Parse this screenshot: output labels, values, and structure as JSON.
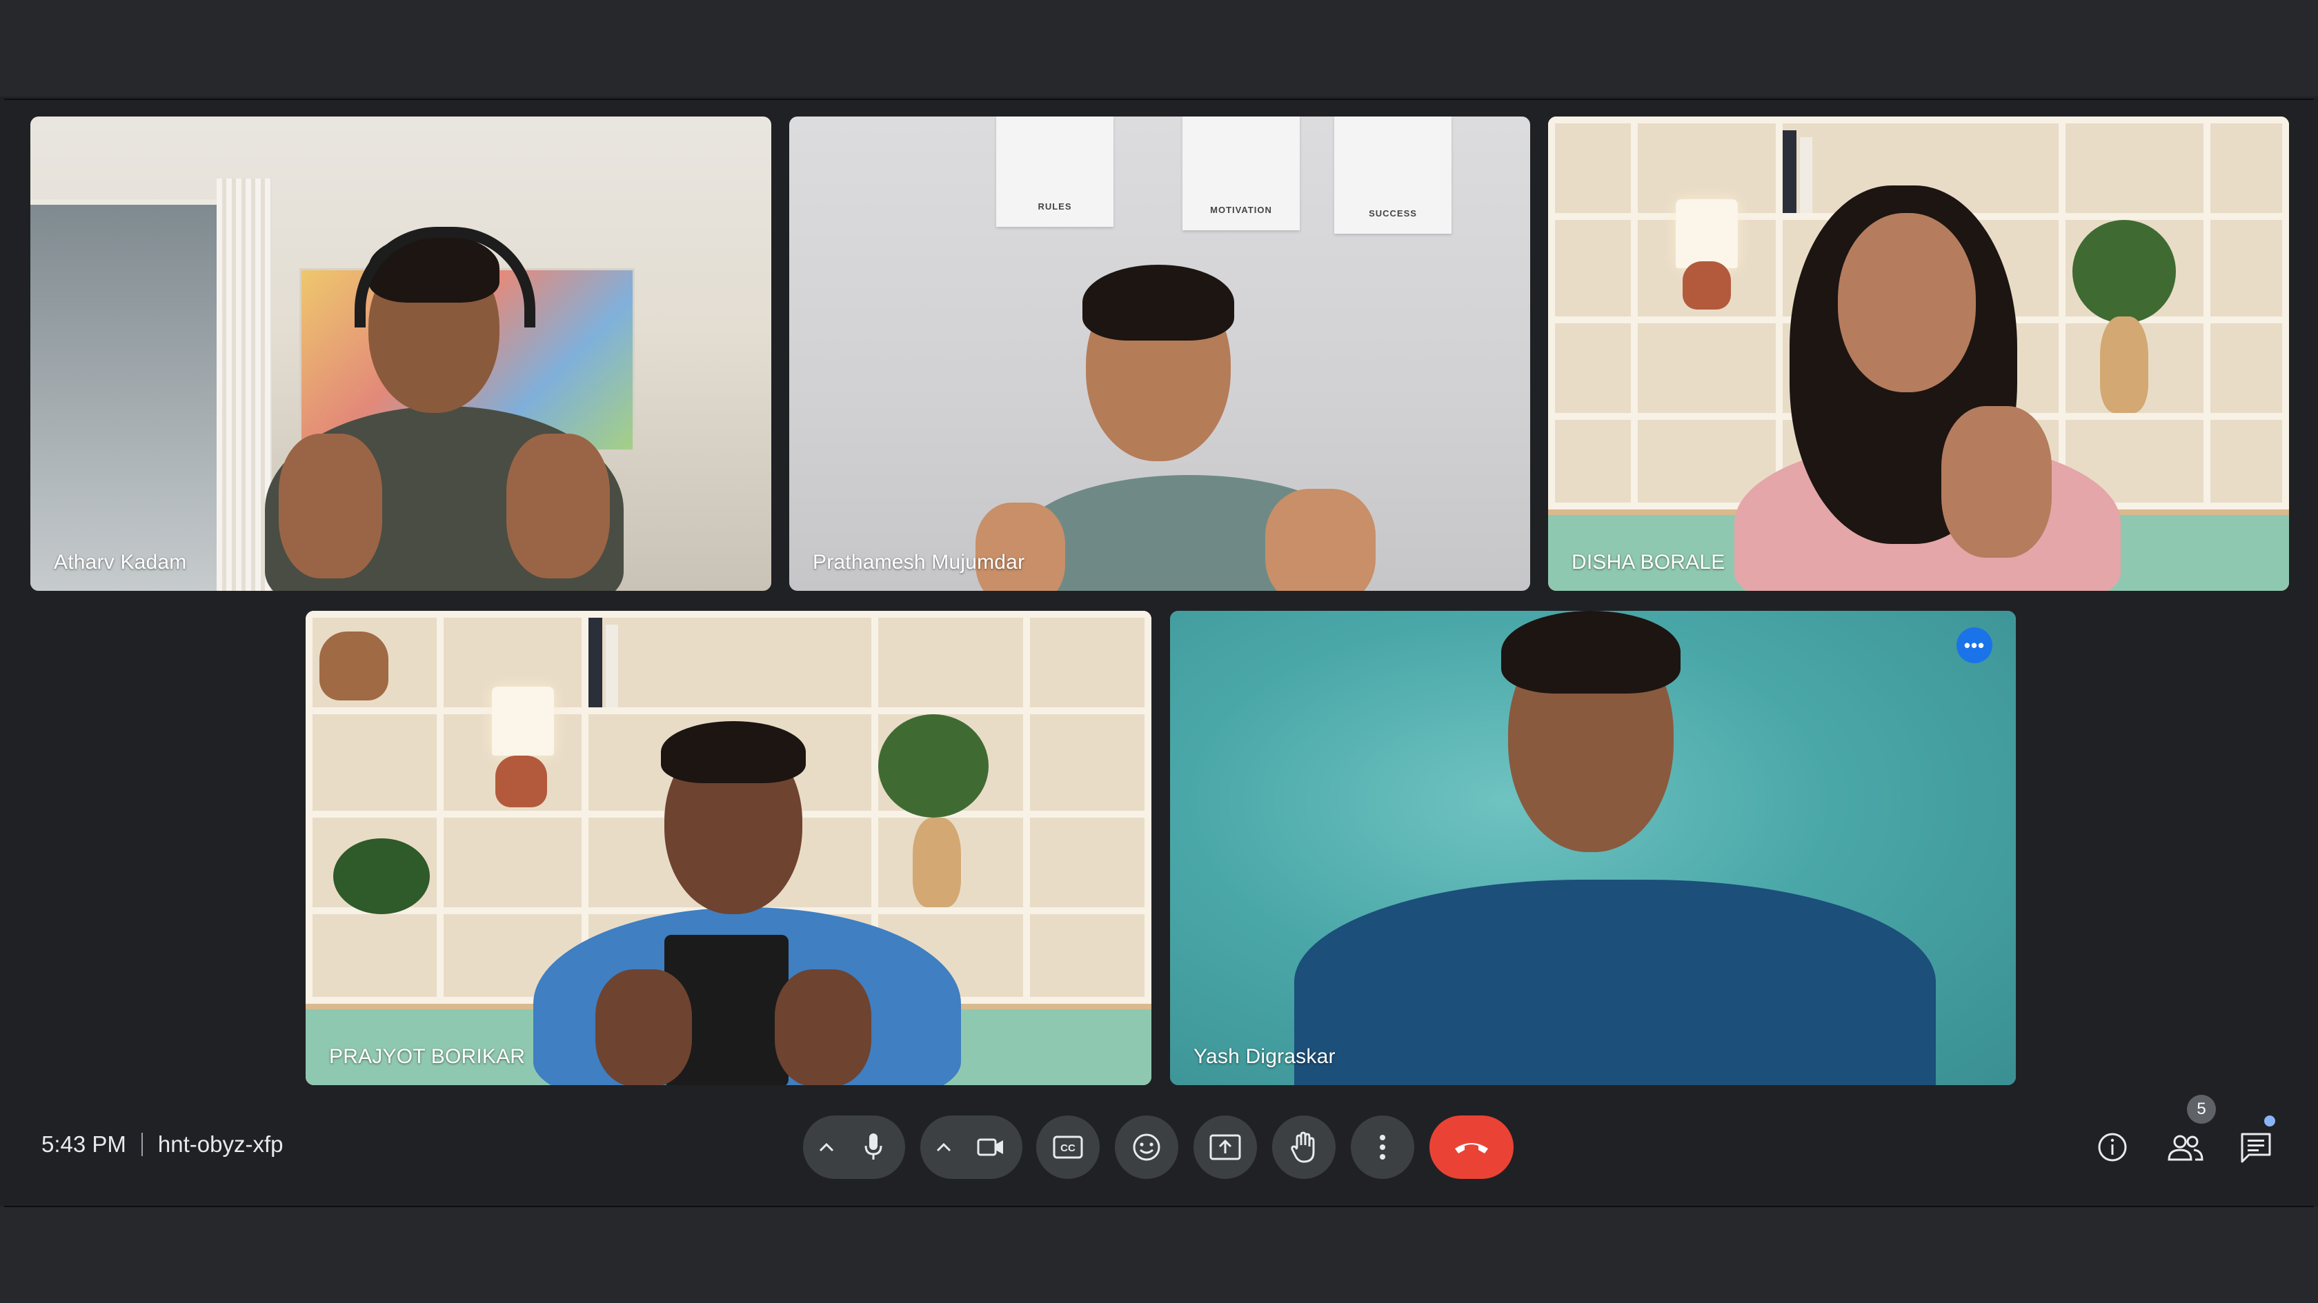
{
  "meeting": {
    "time": "5:43 PM",
    "code": "hnt-obyz-xfp"
  },
  "participants": [
    {
      "name": "Atharv Kadam"
    },
    {
      "name": "Prathamesh Mujumdar"
    },
    {
      "name": "DISHA BORALE"
    },
    {
      "name": "PRAJYOT BORIKAR"
    },
    {
      "name": "Yash Digraskar",
      "active": true
    }
  ],
  "posters": [
    "RULES",
    "MOTIVATION",
    "SUCCESS"
  ],
  "tile_menu": {
    "label": "•••"
  },
  "controls": {
    "mic": {
      "icon": "mic-icon",
      "options_icon": "chevron-up-icon"
    },
    "camera": {
      "icon": "videocam-icon",
      "options_icon": "chevron-up-icon"
    },
    "captions": {
      "icon": "closed-captions-icon"
    },
    "reactions": {
      "icon": "emoji-icon"
    },
    "present": {
      "icon": "present-screen-icon"
    },
    "raise_hand": {
      "icon": "hand-icon"
    },
    "more": {
      "icon": "more-vert-icon"
    },
    "leave": {
      "icon": "call-end-icon",
      "color": "#ea4335"
    }
  },
  "side_controls": {
    "info": {
      "icon": "info-icon"
    },
    "people": {
      "icon": "people-icon",
      "count": "5"
    },
    "chat": {
      "icon": "chat-icon"
    }
  },
  "colors": {
    "background": "#202124",
    "control_bg": "#3c4043",
    "active_border": "#4f86ec",
    "end_call": "#ea4335"
  }
}
